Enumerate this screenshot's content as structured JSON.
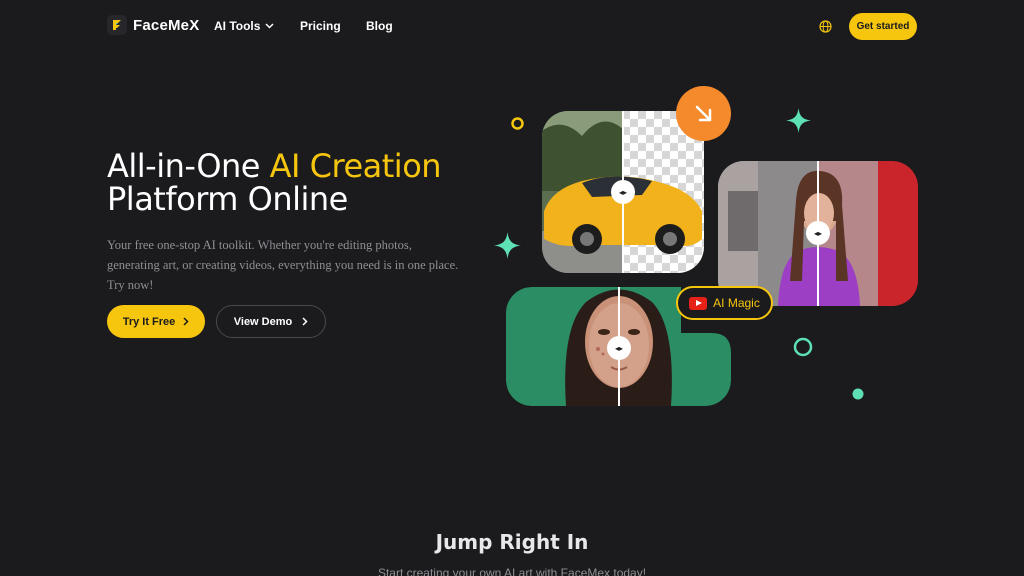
{
  "nav": {
    "brand": "FaceMeX",
    "links": [
      "AI Tools",
      "Pricing",
      "Blog"
    ],
    "cta": "Get started"
  },
  "hero": {
    "title_line1_prefix": "All-in-One ",
    "title_line1_accent": "AI Creation",
    "title_line2": "Platform Online",
    "description": "Your free one-stop AI toolkit. Whether you're editing photos, generating art, or creating videos, everything you need is in one place. Try now!",
    "primary_button": "Try It Free",
    "secondary_button": "View Demo"
  },
  "badge": {
    "label": "AI Magic"
  },
  "section": {
    "title": "Jump Right In",
    "subtitle": "Start creating your own AI art with FaceMex today!"
  },
  "colors": {
    "background": "#1b1b1e",
    "accent": "#f6c60f",
    "orange": "#f58a2c",
    "mint": "#5ee0b5"
  },
  "icons": [
    "facemex-logo-icon",
    "chevron-down-icon",
    "globe-icon",
    "chevron-right-icon",
    "arrow-down-right-icon",
    "youtube-icon",
    "sparkle-icon"
  ]
}
